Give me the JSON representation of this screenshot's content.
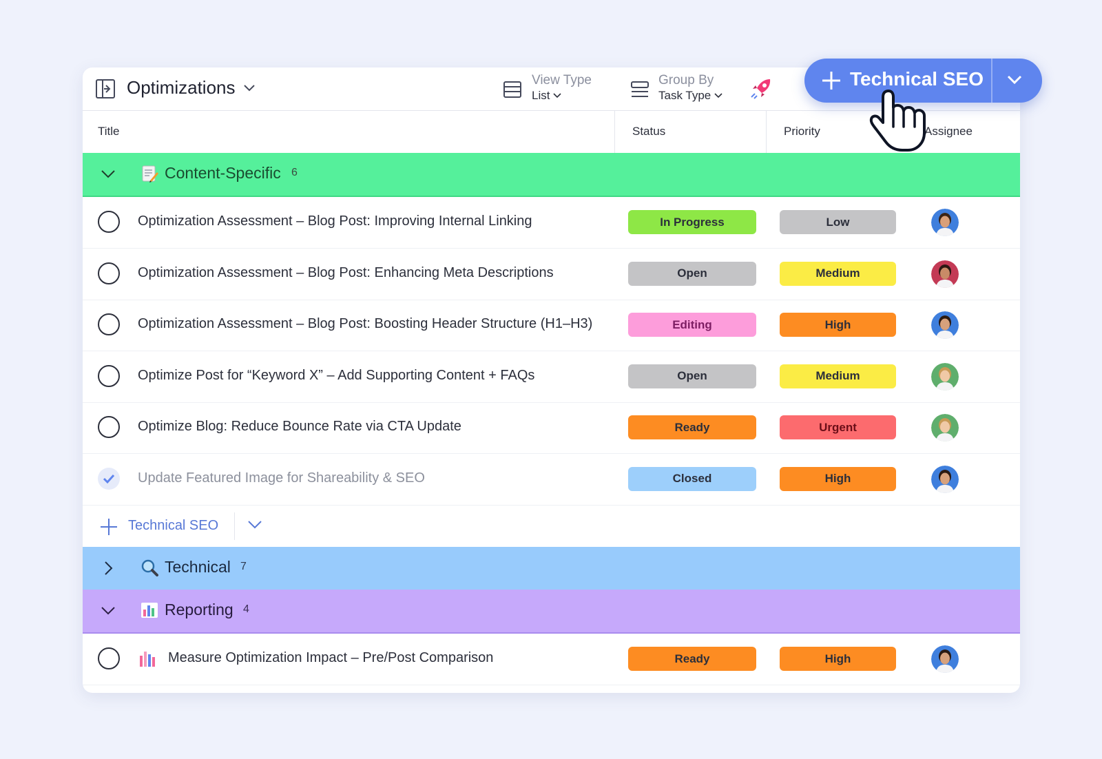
{
  "toolbar": {
    "list_title": "Optimizations",
    "view_type_label": "View Type",
    "view_type_value": "List",
    "group_by_label": "Group By",
    "group_by_value": "Task Type"
  },
  "add_button": {
    "label": "Technical SEO"
  },
  "columns": {
    "title": "Title",
    "status": "Status",
    "priority": "Priority",
    "assignee": "Assignee"
  },
  "groups": [
    {
      "name": "Content-Specific",
      "count": "6",
      "color": "#55f09b",
      "expanded": true,
      "icon": "memo-icon"
    },
    {
      "name": "Technical",
      "count": "7",
      "color": "#98cbfc",
      "expanded": false,
      "icon": "magnifier-icon"
    },
    {
      "name": "Reporting",
      "count": "4",
      "color": "#c6a9fb",
      "expanded": true,
      "icon": "bar-chart-icon"
    }
  ],
  "rows": [
    {
      "title": "Optimization Assessment – Blog Post: Improving Internal Linking",
      "status": "In Progress",
      "priority": "Low",
      "done": false
    },
    {
      "title": "Optimization Assessment – Blog Post: Enhancing Meta Descriptions",
      "status": "Open",
      "priority": "Medium",
      "done": false
    },
    {
      "title": "Optimization Assessment – Blog Post: Boosting Header Structure (H1–H3)",
      "status": "Editing",
      "priority": "High",
      "done": false
    },
    {
      "title": "Optimize Post for “Keyword X” – Add Supporting Content + FAQs",
      "status": "Open",
      "priority": "Medium",
      "done": false
    },
    {
      "title": "Optimize Blog: Reduce Bounce Rate via CTA Update",
      "status": "Ready",
      "priority": "Urgent",
      "done": false
    },
    {
      "title": "Update Featured Image for Shareability & SEO",
      "status": "Closed",
      "priority": "High",
      "done": true
    }
  ],
  "add_row": {
    "label": "Technical SEO"
  },
  "reporting_rows": [
    {
      "title": "Measure Optimization Impact – Pre/Post Comparison",
      "status": "Ready",
      "priority": "High",
      "done": false
    }
  ],
  "status_colors": {
    "In Progress": "#8ee746",
    "Open": "#c4c4c6",
    "Editing": "#fd9ddb",
    "Ready": "#fd8c22",
    "Closed": "#9dcffb"
  },
  "priority_colors": {
    "Low": "#c4c4c6",
    "Medium": "#fbec45",
    "High": "#fd8c22",
    "Urgent": "#fc6b6e"
  },
  "status_text_colors": {
    "Editing": "#7d1e63"
  },
  "priority_text_colors": {
    "Urgent": "#6b0e18"
  }
}
